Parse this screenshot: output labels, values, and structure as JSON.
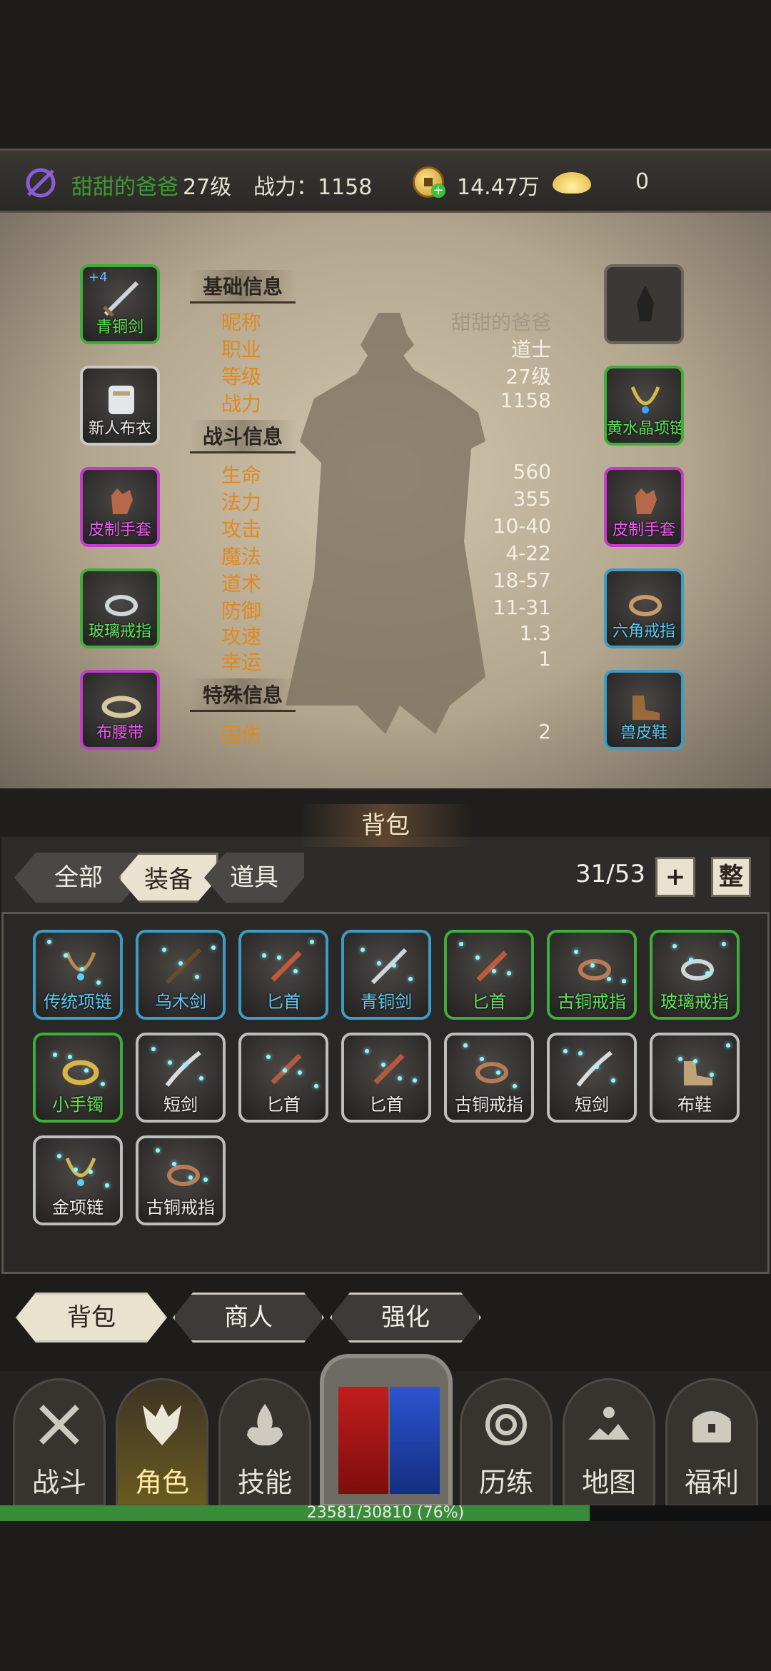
{
  "topbar": {
    "player_name": "甜甜的爸爸",
    "level": "27级",
    "power": "战力：1158",
    "gold": "14.47万",
    "ingot": "0"
  },
  "equip_left": [
    {
      "label": "青铜剑",
      "quality": "green",
      "enhance": "+4",
      "icon": "sword-icon"
    },
    {
      "label": "新人布衣",
      "quality": "white",
      "icon": "armor-icon"
    },
    {
      "label": "皮制手套",
      "quality": "purple",
      "icon": "glove-icon"
    },
    {
      "label": "玻璃戒指",
      "quality": "green",
      "icon": "ring-icon"
    },
    {
      "label": "布腰带",
      "quality": "purple",
      "icon": "belt-icon"
    }
  ],
  "equip_right": [
    {
      "label": "",
      "quality": "empty",
      "icon": "helmet-slot-icon"
    },
    {
      "label": "黄水晶项链",
      "quality": "green",
      "icon": "necklace-icon"
    },
    {
      "label": "皮制手套",
      "quality": "purple",
      "icon": "glove-icon"
    },
    {
      "label": "六角戒指",
      "quality": "blue",
      "icon": "ring-icon"
    },
    {
      "label": "兽皮鞋",
      "quality": "blue",
      "icon": "boots-icon"
    }
  ],
  "stats": {
    "basic_header": "基础信息",
    "basic": [
      {
        "label": "昵称",
        "value": "甜甜的爸爸"
      },
      {
        "label": "职业",
        "value": "道士"
      },
      {
        "label": "等级",
        "value": "27级"
      },
      {
        "label": "战力",
        "value": "1158"
      }
    ],
    "combat_header": "战斗信息",
    "combat": [
      {
        "label": "生命",
        "value": "560"
      },
      {
        "label": "法力",
        "value": "355"
      },
      {
        "label": "攻击",
        "value": "10-40"
      },
      {
        "label": "魔法",
        "value": "4-22"
      },
      {
        "label": "道术",
        "value": "18-57"
      },
      {
        "label": "防御",
        "value": "11-31"
      },
      {
        "label": "攻速",
        "value": "1.3"
      },
      {
        "label": "幸运",
        "value": "1"
      }
    ],
    "special_header": "特殊信息",
    "special": [
      {
        "label": "固伤",
        "value": "2"
      }
    ]
  },
  "bag": {
    "title": "背包",
    "tabs": [
      "全部",
      "装备",
      "道具"
    ],
    "selected_tab": "装备",
    "count": "31/53",
    "add_label": "+",
    "sort_label": "整",
    "items": [
      {
        "label": "传统项链",
        "quality": "blue",
        "icon": "necklace-icon"
      },
      {
        "label": "乌木剑",
        "quality": "blue",
        "icon": "sword-icon"
      },
      {
        "label": "匕首",
        "quality": "blue",
        "icon": "dagger-icon"
      },
      {
        "label": "青铜剑",
        "quality": "blue",
        "icon": "sword-icon"
      },
      {
        "label": "匕首",
        "quality": "green",
        "icon": "dagger-icon"
      },
      {
        "label": "古铜戒指",
        "quality": "green",
        "icon": "ring-icon"
      },
      {
        "label": "玻璃戒指",
        "quality": "green",
        "icon": "ring-icon"
      },
      {
        "label": "小手镯",
        "quality": "green",
        "icon": "bracelet-icon"
      },
      {
        "label": "短剑",
        "quality": "white",
        "icon": "sword-icon"
      },
      {
        "label": "匕首",
        "quality": "white",
        "icon": "dagger-icon"
      },
      {
        "label": "匕首",
        "quality": "white",
        "icon": "dagger-icon"
      },
      {
        "label": "古铜戒指",
        "quality": "white",
        "icon": "ring-icon"
      },
      {
        "label": "短剑",
        "quality": "white",
        "icon": "sword-icon"
      },
      {
        "label": "布鞋",
        "quality": "white",
        "icon": "boots-icon"
      },
      {
        "label": "金项链",
        "quality": "white",
        "icon": "necklace-icon"
      },
      {
        "label": "古铜戒指",
        "quality": "white",
        "icon": "ring-icon"
      }
    ]
  },
  "lower_tabs": [
    "背包",
    "商人",
    "强化"
  ],
  "nav": [
    "战斗",
    "角色",
    "技能",
    "历练",
    "地图",
    "福利"
  ],
  "nav_selected": "角色",
  "exp": {
    "text": "23581/30810 (76%)",
    "fraction": 0.765
  }
}
